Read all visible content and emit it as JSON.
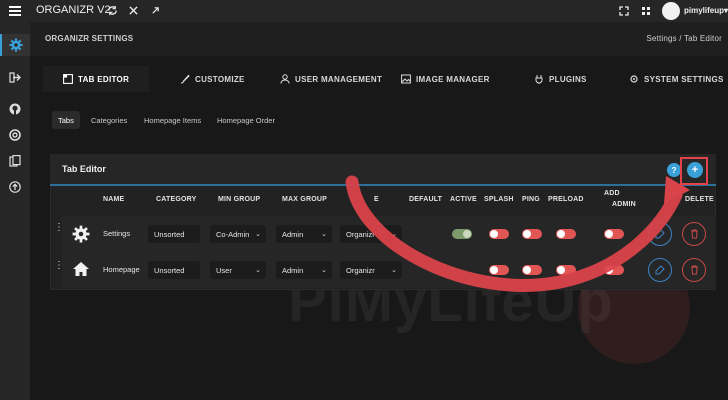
{
  "topbar": {
    "app_title": "ORGANIZR V2",
    "username": "pimylifeup"
  },
  "sidebar": {
    "icons": [
      "settings-icon",
      "logout-icon",
      "github-icon",
      "help-icon",
      "docs-icon",
      "upload-icon"
    ]
  },
  "page": {
    "section_title": "ORGANIZR SETTINGS",
    "breadcrumb": "Settings / Tab Editor"
  },
  "tabs": [
    {
      "label": "TAB EDITOR",
      "active": true
    },
    {
      "label": "CUSTOMIZE"
    },
    {
      "label": "USER MANAGEMENT"
    },
    {
      "label": "IMAGE MANAGER"
    },
    {
      "label": "PLUGINS"
    },
    {
      "label": "SYSTEM SETTINGS"
    }
  ],
  "subtabs": [
    "Tabs",
    "Categories",
    "Homepage Items",
    "Homepage Order"
  ],
  "panel": {
    "title": "Tab Editor",
    "columns": [
      "NAME",
      "CATEGORY",
      "MIN GROUP",
      "MAX GROUP",
      "TYPE",
      "DEFAULT",
      "ACTIVE",
      "SPLASH",
      "PING",
      "PRELOAD",
      "ADD TO ADMIN",
      "EDIT",
      "DELETE"
    ],
    "visible_columns": {
      "name": "NAME",
      "category": "CATEGORY",
      "min_group": "MIN GROUP",
      "max_group": "MAX GROUP",
      "type_partial": "E",
      "default": "DEFAULT",
      "active": "ACTIVE",
      "splash": "SPLASH",
      "ping": "PING",
      "preload": "PRELOAD",
      "admin_line1": "ADD",
      "admin_line2": "ADMIN",
      "delete": "DELETE"
    },
    "rows": [
      {
        "name": "Settings",
        "category": "Unsorted",
        "min_group": "Co-Admin",
        "max_group": "Admin",
        "type": "Organizr",
        "icon": "gear-icon",
        "active": true,
        "splash": false,
        "ping": false,
        "preload": false,
        "admin": false
      },
      {
        "name": "Homepage",
        "category": "Unsorted",
        "min_group": "User",
        "max_group": "Admin",
        "type": "Organizr",
        "icon": "home-icon",
        "active": false,
        "splash": false,
        "ping": false,
        "preload": false,
        "admin": false
      }
    ]
  },
  "colors": {
    "accent_blue": "#3aa0d8",
    "toggle_red": "#e25555",
    "annotation_red": "#d9434a",
    "highlight_box": "#e3424a"
  },
  "watermark": {
    "text": "PiMyLifeUp"
  }
}
